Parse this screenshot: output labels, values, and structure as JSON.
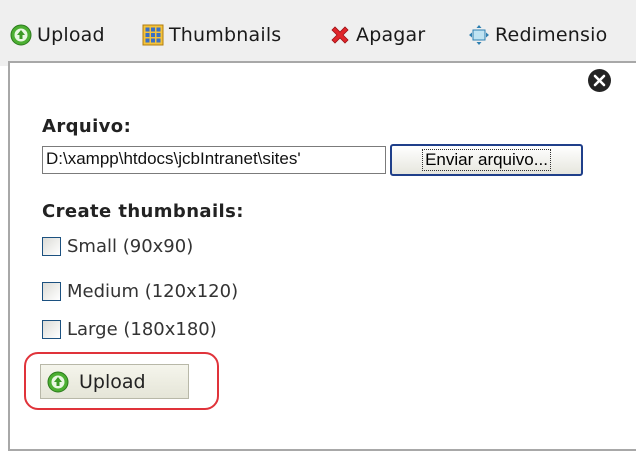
{
  "toolbar": {
    "items": [
      {
        "label": "Upload",
        "icon": "upload-icon"
      },
      {
        "label": "Thumbnails",
        "icon": "thumbnails-icon"
      },
      {
        "label": "Apagar",
        "icon": "delete-icon"
      },
      {
        "label": "Redimensio",
        "icon": "resize-icon"
      }
    ]
  },
  "panel": {
    "close_icon": "close-icon",
    "file_label": "Arquivo:",
    "file_value": "D:\\xampp\\htdocs\\jcbIntranet\\sites'",
    "browse_label": "Enviar arquivo...",
    "thumbs_label": "Create thumbnails:",
    "options": [
      {
        "label": "Small (90x90)",
        "checked": false
      },
      {
        "label": "Medium (120x120)",
        "checked": false
      },
      {
        "label": "Large (180x180)",
        "checked": false
      }
    ],
    "upload_label": "Upload"
  },
  "colors": {
    "toolbar_bg": "#efefef",
    "highlight": "#e0333a",
    "delete_red": "#e0262b",
    "upload_green": "#4caf32"
  }
}
